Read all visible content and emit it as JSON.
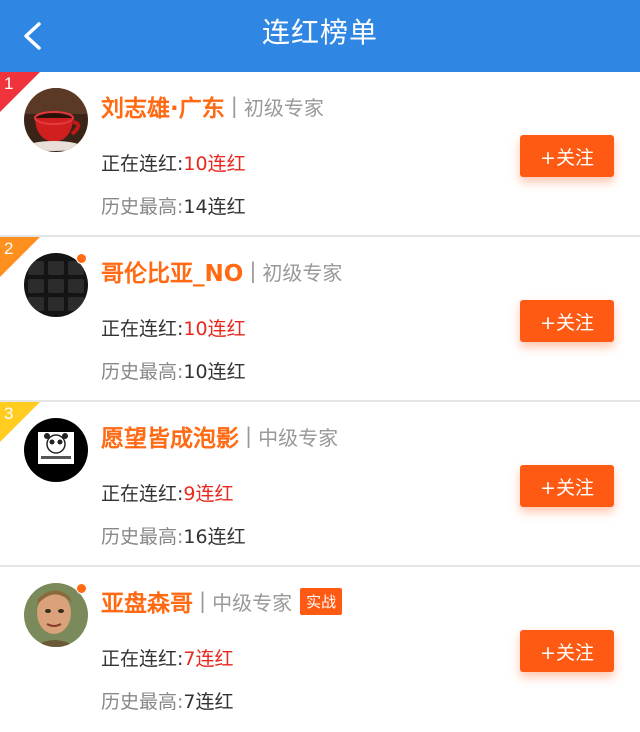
{
  "header": {
    "title": "连红榜单"
  },
  "colors": {
    "header_bg": "#2f86e3",
    "accent": "#ff6a13",
    "button": "#ff5a13",
    "streak_red": "#e8281e"
  },
  "list": {
    "current_prefix": "正在连红:",
    "best_prefix": "历史最高:",
    "follow_label": "+关注",
    "items": [
      {
        "rank": "1",
        "rank_color": "#f0343b",
        "name": "刘志雄·广东",
        "sep": "|",
        "level": "初级专家",
        "tag": "",
        "current": "10连红",
        "best": "14连红",
        "online": false,
        "avatar_icon": "coffee-cup-avatar"
      },
      {
        "rank": "2",
        "rank_color": "#ff8f1f",
        "name": "哥伦比亚_NO",
        "sep": "|",
        "level": "初级专家",
        "tag": "",
        "current": "10连红",
        "best": "10连红",
        "online": true,
        "avatar_icon": "keyboard-avatar"
      },
      {
        "rank": "3",
        "rank_color": "#ffcc1f",
        "name": "愿望皆成泡影",
        "sep": "|",
        "level": "中级专家",
        "tag": "",
        "current": "9连红",
        "best": "16连红",
        "online": false,
        "avatar_icon": "panda-meme-avatar"
      },
      {
        "rank": "",
        "rank_color": "",
        "name": "亚盘森哥",
        "sep": "|",
        "level": "中级专家",
        "tag": "实战",
        "current": "7连红",
        "best": "7连红",
        "online": true,
        "avatar_icon": "person-photo-avatar"
      }
    ]
  }
}
